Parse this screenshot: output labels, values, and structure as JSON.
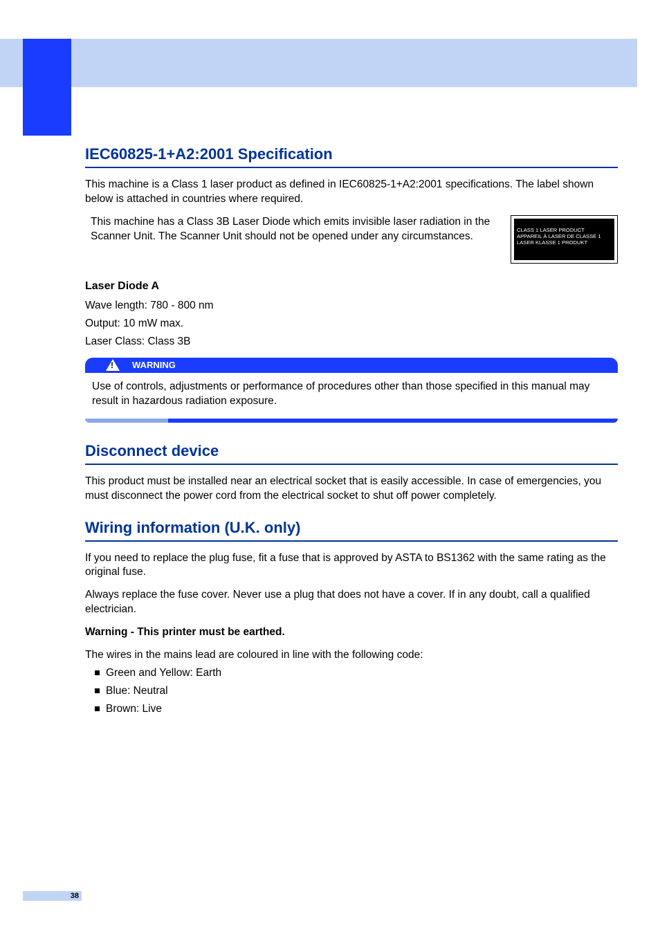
{
  "sections": {
    "iec": {
      "title": "IEC60825-1+A2:2001 Specification",
      "intro": "This machine is a Class 1 laser product as defined in IEC60825-1+A2:2001 specifications. The label shown below is attached in countries where required.",
      "diode_note": "This machine has a Class 3B Laser Diode which emits invisible laser radiation in the Scanner Unit. The Scanner Unit should not be opened under any circumstances.",
      "label_lines": [
        "CLASS 1 LASER PRODUCT",
        "APPAREIL À LASER DE CLASSE 1",
        "LASER KLASSE 1 PRODUKT"
      ],
      "laser_heading": "Laser Diode A",
      "laser_wave": "Wave length: 780 - 800 nm",
      "laser_output": "Output: 10 mW max.",
      "laser_class": "Laser Class: Class 3B",
      "warning_label": "WARNING",
      "warning_body": "Use of controls, adjustments or performance of procedures other than those specified in this manual may result in hazardous radiation exposure."
    },
    "disconnect": {
      "title": "Disconnect device",
      "body": "This product must be installed near an electrical socket that is easily accessible. In case of emergencies, you must disconnect the power cord from the electrical socket to shut off power completely."
    },
    "wiring": {
      "title": "Wiring information (U.K. only)",
      "p1": "If you need to replace the plug fuse, fit a fuse that is approved by ASTA to BS1362 with the same rating as the original fuse.",
      "p2": "Always replace the fuse cover. Never use a plug that does not have a cover. If in any doubt, call a qualified electrician.",
      "warn_bold": "Warning - This printer must be earthed.",
      "wires_intro": "The wires in the mains lead are coloured in line with the following code:",
      "bullets": [
        "Green and Yellow: Earth",
        "Blue: Neutral",
        "Brown: Live"
      ]
    }
  },
  "page_number": "38"
}
